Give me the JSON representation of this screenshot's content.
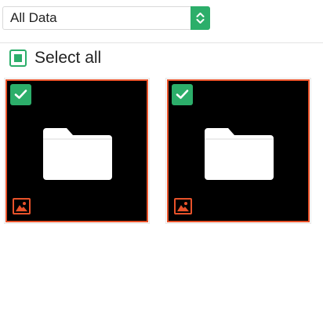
{
  "filter": {
    "selected": "All Data"
  },
  "selection": {
    "select_all_label": "Select all",
    "all_selected": true
  },
  "items": [
    {
      "type": "folder",
      "selected": true,
      "icon": "folder-icon",
      "badge": "image-icon"
    },
    {
      "type": "folder",
      "selected": true,
      "icon": "folder-icon",
      "badge": "image-icon"
    }
  ],
  "colors": {
    "accent_green": "#2cae6a",
    "accent_orange": "#e8522a",
    "tile_background": "#000000"
  }
}
